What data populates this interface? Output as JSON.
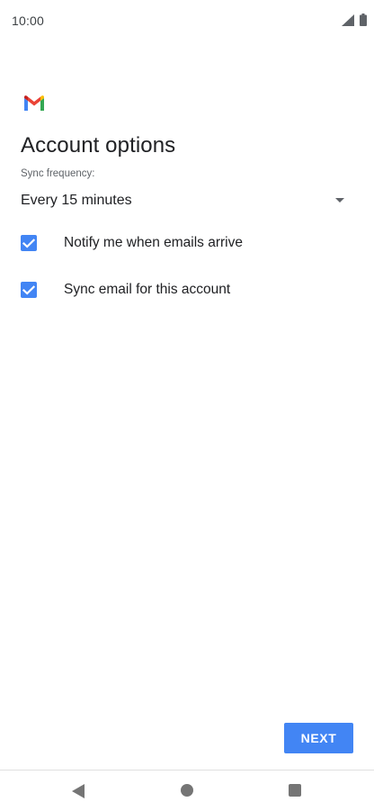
{
  "status_bar": {
    "time": "10:00",
    "icons": [
      "signal-icon",
      "battery-icon"
    ]
  },
  "logo": {
    "name": "gmail-logo",
    "colors": [
      "#4285f4",
      "#ea4335",
      "#fbbc04",
      "#34a853",
      "#c5221f"
    ]
  },
  "page": {
    "title": "Account options"
  },
  "sync": {
    "label": "Sync frequency:",
    "selected": "Every 15 minutes"
  },
  "options": [
    {
      "label": "Notify me when emails arrive",
      "checked": true
    },
    {
      "label": "Sync email for this account",
      "checked": true
    }
  ],
  "actions": {
    "next_label": "NEXT"
  },
  "navigation": {
    "icons": [
      "back-icon",
      "home-icon",
      "recents-icon"
    ]
  },
  "colors": {
    "accent": "#4285f4",
    "text_primary": "#202124",
    "text_secondary": "#5f6368",
    "nav_icon": "#757575"
  }
}
